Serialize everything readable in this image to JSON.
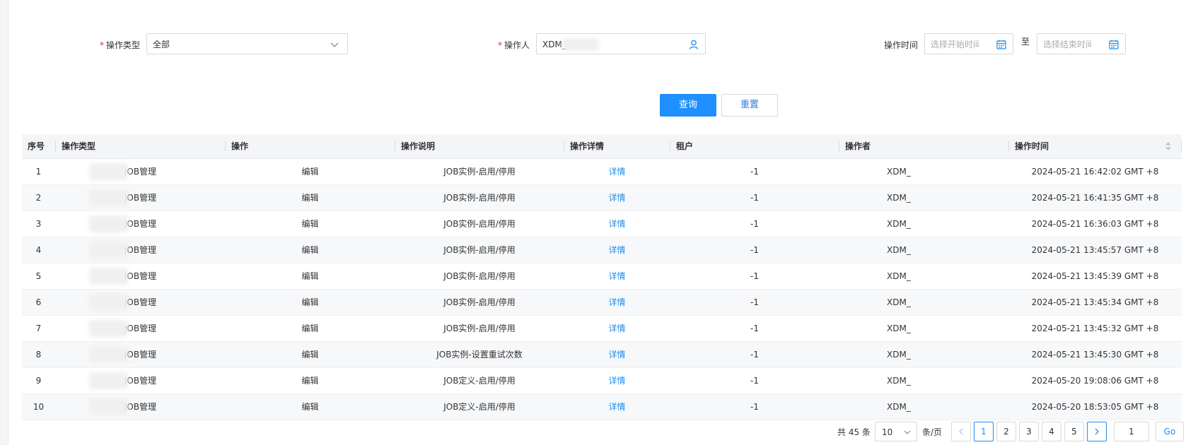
{
  "filters": {
    "type_label": "操作类型",
    "type_value": "全部",
    "operator_label": "操作人",
    "operator_value": "XDM_",
    "time_label": "操作时间",
    "start_placeholder": "选择开始时间",
    "to_label": "至",
    "end_placeholder": "选择结束时间"
  },
  "buttons": {
    "query": "查询",
    "reset": "重置"
  },
  "table": {
    "headers": [
      "序号",
      "操作类型",
      "操作",
      "操作说明",
      "操作详情",
      "租户",
      "操作者",
      "操作时间"
    ],
    "rows": [
      {
        "no": "1",
        "type": "JOB管理",
        "op": "编辑",
        "desc": "JOB实例-启用/停用",
        "detail": "详情",
        "tenant": "-1",
        "operator": "XDM_",
        "time": "2024-05-21 16:42:02 GMT +8"
      },
      {
        "no": "2",
        "type": "JOB管理",
        "op": "编辑",
        "desc": "JOB实例-启用/停用",
        "detail": "详情",
        "tenant": "-1",
        "operator": "XDM_",
        "time": "2024-05-21 16:41:35 GMT +8"
      },
      {
        "no": "3",
        "type": "JOB管理",
        "op": "编辑",
        "desc": "JOB实例-启用/停用",
        "detail": "详情",
        "tenant": "-1",
        "operator": "XDM_",
        "time": "2024-05-21 16:36:03 GMT +8"
      },
      {
        "no": "4",
        "type": "JOB管理",
        "op": "编辑",
        "desc": "JOB实例-启用/停用",
        "detail": "详情",
        "tenant": "-1",
        "operator": "XDM_",
        "time": "2024-05-21 13:45:57 GMT +8"
      },
      {
        "no": "5",
        "type": "JOB管理",
        "op": "编辑",
        "desc": "JOB实例-启用/停用",
        "detail": "详情",
        "tenant": "-1",
        "operator": "XDM_",
        "time": "2024-05-21 13:45:39 GMT +8"
      },
      {
        "no": "6",
        "type": "JOB管理",
        "op": "编辑",
        "desc": "JOB实例-启用/停用",
        "detail": "详情",
        "tenant": "-1",
        "operator": "XDM_",
        "time": "2024-05-21 13:45:34 GMT +8"
      },
      {
        "no": "7",
        "type": "JOB管理",
        "op": "编辑",
        "desc": "JOB实例-启用/停用",
        "detail": "详情",
        "tenant": "-1",
        "operator": "XDM_",
        "time": "2024-05-21 13:45:32 GMT +8"
      },
      {
        "no": "8",
        "type": "JOB管理",
        "op": "编辑",
        "desc": "JOB实例-设置重试次数",
        "detail": "详情",
        "tenant": "-1",
        "operator": "XDM_",
        "time": "2024-05-21 13:45:30 GMT +8"
      },
      {
        "no": "9",
        "type": "JOB管理",
        "op": "编辑",
        "desc": "JOB定义-启用/停用",
        "detail": "详情",
        "tenant": "-1",
        "operator": "XDM_",
        "time": "2024-05-20 19:08:06 GMT +8"
      },
      {
        "no": "10",
        "type": "JOB管理",
        "op": "编辑",
        "desc": "JOB定义-启用/停用",
        "detail": "详情",
        "tenant": "-1",
        "operator": "XDM_",
        "time": "2024-05-20 18:53:05 GMT +8"
      }
    ]
  },
  "pagination": {
    "total_text": "共 45 条",
    "page_size": "10",
    "per_page_text": "条/页",
    "pages": [
      "1",
      "2",
      "3",
      "4",
      "5"
    ],
    "current": "1",
    "jump_value": "1",
    "go_label": "Go"
  },
  "colors": {
    "primary": "#1e90ff",
    "link": "#1e8cf0",
    "required": "#f5222d"
  }
}
